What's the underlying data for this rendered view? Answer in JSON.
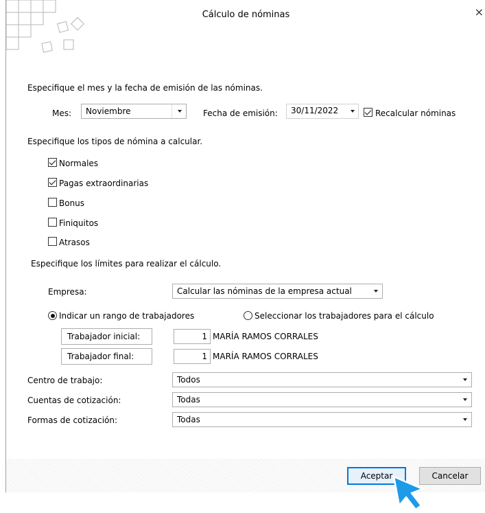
{
  "window": {
    "title": "Cálculo de nóminas",
    "close_glyph": "×"
  },
  "section1": {
    "heading": "Especifique el mes y la fecha de emisión de las nóminas.",
    "month_label": "Mes:",
    "month_value": "Noviembre",
    "date_label": "Fecha de emisión:",
    "date_value": "30/11/2022",
    "recalc_label": "Recalcular nóminas",
    "recalc_checked": true
  },
  "section2": {
    "heading": "Especifique los tipos de nómina a calcular.",
    "types": [
      {
        "label": "Normales",
        "checked": true
      },
      {
        "label": "Pagas extraordinarias",
        "checked": true
      },
      {
        "label": "Bonus",
        "checked": false
      },
      {
        "label": "Finiquitos",
        "checked": false
      },
      {
        "label": "Atrasos",
        "checked": false
      }
    ]
  },
  "section3": {
    "heading": "Especifique los límites para realizar el cálculo.",
    "company_label": "Empresa:",
    "company_value": "Calcular las nóminas de la empresa actual",
    "radio_range": "Indicar un rango de trabajadores",
    "radio_select": "Seleccionar los trabajadores para el cálculo",
    "selected_radio": "range",
    "worker_start_label": "Trabajador inicial:",
    "worker_start_num": "1",
    "worker_start_name": "MARÍA RAMOS CORRALES",
    "worker_end_label": "Trabajador final:",
    "worker_end_num": "1",
    "worker_end_name": "MARÍA RAMOS CORRALES",
    "center_label": "Centro de trabajo:",
    "center_value": "Todos",
    "accounts_label": "Cuentas de cotización:",
    "accounts_value": "Todas",
    "forms_label": "Formas de cotización:",
    "forms_value": "Todas"
  },
  "buttons": {
    "accept": "Aceptar",
    "cancel": "Cancelar"
  },
  "colors": {
    "accent": "#0078d7",
    "cursor": "#1e9be8"
  }
}
